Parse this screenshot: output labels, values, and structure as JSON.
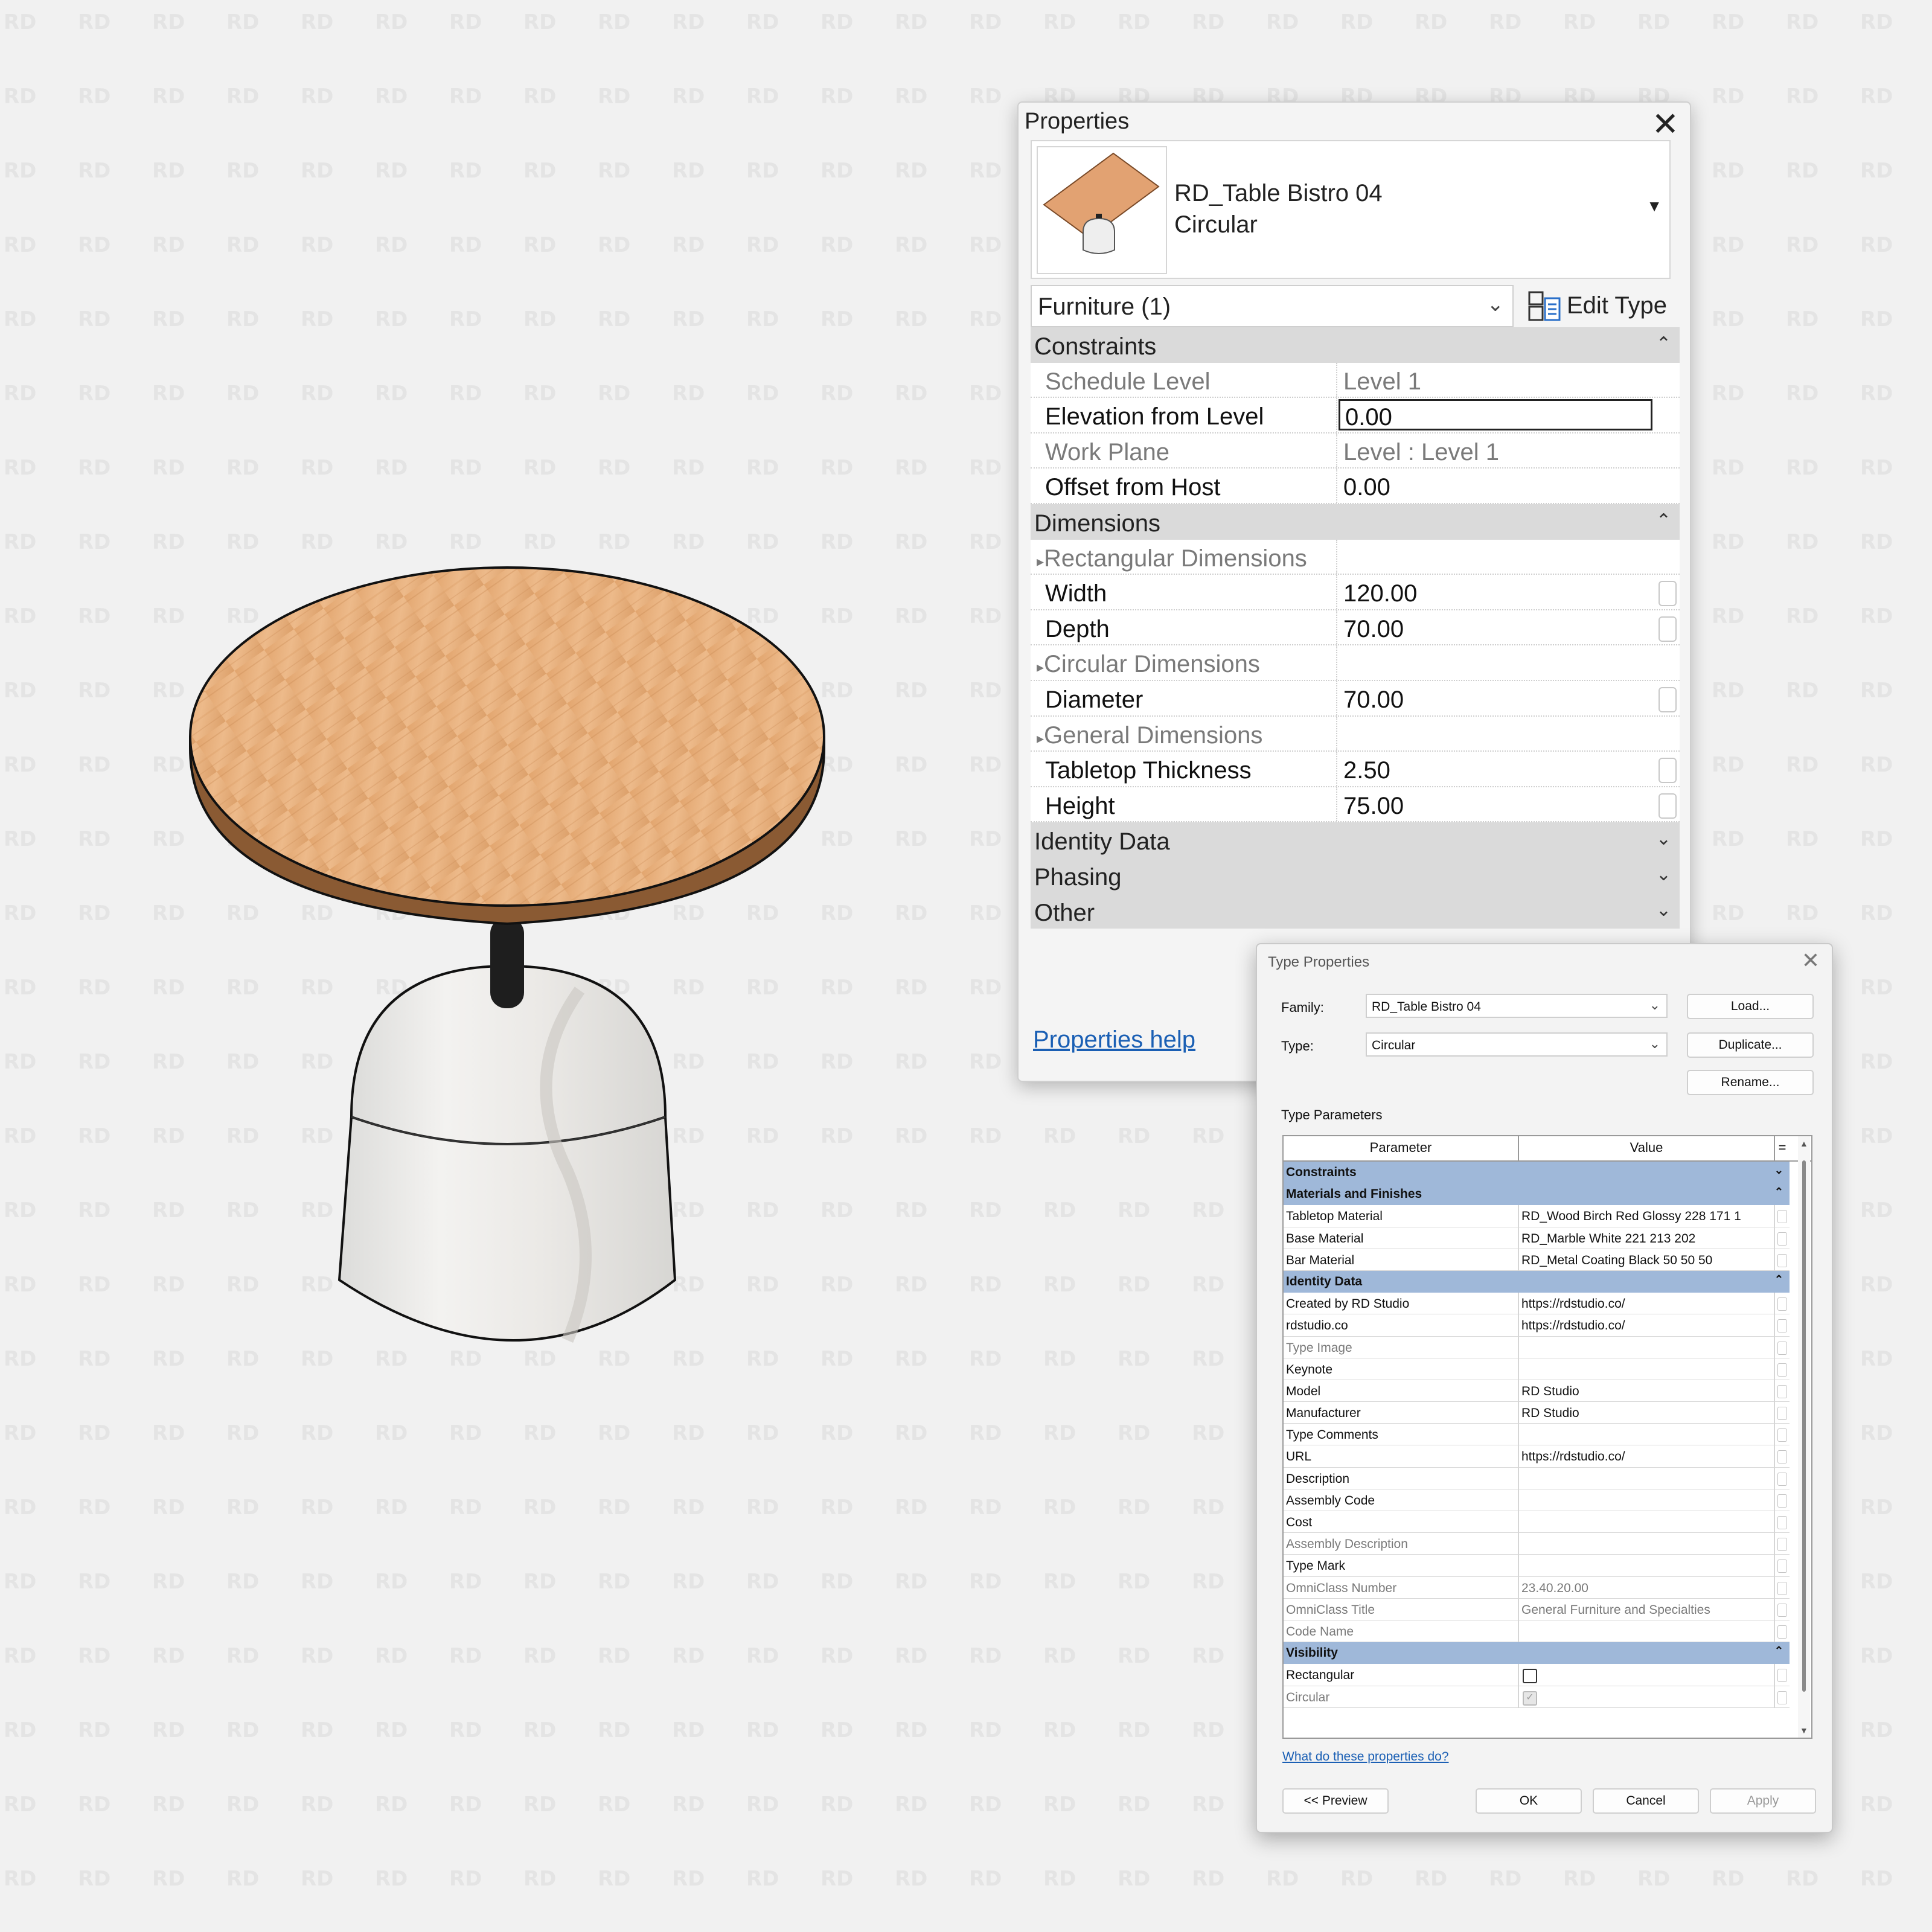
{
  "properties": {
    "title": "Properties",
    "family_name": "RD_Table Bistro 04",
    "family_type": "Circular",
    "filter_label": "Furniture (1)",
    "edit_type_label": "Edit Type",
    "groups": {
      "constraints": "Constraints",
      "dimensions": "Dimensions",
      "identity": "Identity Data",
      "phasing": "Phasing",
      "other": "Other"
    },
    "constraints": [
      {
        "name": "Schedule Level",
        "value": "Level 1"
      },
      {
        "name": "Elevation from Level",
        "value": "0.00"
      },
      {
        "name": "Work Plane",
        "value": "Level : Level 1"
      },
      {
        "name": "Offset from Host",
        "value": "0.00"
      }
    ],
    "dimensions": {
      "rect_header": "Rectangular Dimensions",
      "width_name": "Width",
      "width_value": "120.00",
      "depth_name": "Depth",
      "depth_value": "70.00",
      "circ_header": "Circular Dimensions",
      "diameter_name": "Diameter",
      "diameter_value": "70.00",
      "general_header": "General Dimensions",
      "thickness_name": "Tabletop Thickness",
      "thickness_value": "2.50",
      "height_name": "Height",
      "height_value": "75.00"
    },
    "help_link": "Properties help"
  },
  "type_properties": {
    "title": "Type Properties",
    "family_label": "Family:",
    "family_value": "RD_Table Bistro 04",
    "type_label": "Type:",
    "type_value": "Circular",
    "load_label": "Load...",
    "duplicate_label": "Duplicate...",
    "rename_label": "Rename...",
    "section_label": "Type Parameters",
    "col_parameter": "Parameter",
    "col_value": "Value",
    "col_eq": "=",
    "groups": {
      "constraints": "Constraints",
      "materials": "Materials and Finishes",
      "identity": "Identity Data",
      "visibility": "Visibility"
    },
    "materials": [
      {
        "name": "Tabletop Material",
        "value": "RD_Wood Birch Red Glossy 228 171 1"
      },
      {
        "name": "Base Material",
        "value": "RD_Marble White 221 213 202"
      },
      {
        "name": "Bar Material",
        "value": "RD_Metal Coating Black 50 50 50"
      }
    ],
    "identity": [
      {
        "name": "Created by RD Studio",
        "value": "https://rdstudio.co/"
      },
      {
        "name": "rdstudio.co",
        "value": "https://rdstudio.co/"
      },
      {
        "name": "Type Image",
        "value": ""
      },
      {
        "name": "Keynote",
        "value": ""
      },
      {
        "name": "Model",
        "value": "RD Studio"
      },
      {
        "name": "Manufacturer",
        "value": "RD Studio"
      },
      {
        "name": "Type Comments",
        "value": ""
      },
      {
        "name": "URL",
        "value": "https://rdstudio.co/"
      },
      {
        "name": "Description",
        "value": ""
      },
      {
        "name": "Assembly Code",
        "value": ""
      },
      {
        "name": "Cost",
        "value": ""
      },
      {
        "name": "Assembly Description",
        "value": ""
      },
      {
        "name": "Type Mark",
        "value": ""
      },
      {
        "name": "OmniClass Number",
        "value": "23.40.20.00"
      },
      {
        "name": "OmniClass Title",
        "value": "General Furniture and Specialties"
      },
      {
        "name": "Code Name",
        "value": ""
      }
    ],
    "visibility": [
      {
        "name": "Rectangular",
        "checked": false
      },
      {
        "name": "Circular",
        "checked": true
      }
    ],
    "help_link": "What do these properties do?",
    "preview_label": "<< Preview",
    "ok_label": "OK",
    "cancel_label": "Cancel",
    "apply_label": "Apply"
  },
  "watermark_text": "RD"
}
